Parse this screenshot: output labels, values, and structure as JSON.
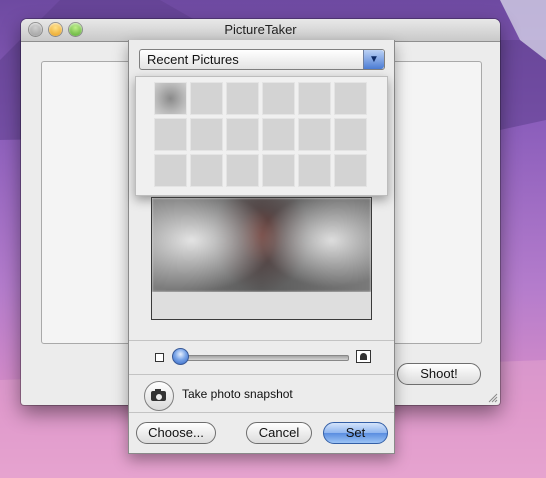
{
  "window": {
    "title": "PictureTaker",
    "shoot_label": "Shoot!"
  },
  "panel": {
    "popup_label": "Recent Pictures",
    "recent_pictures": [
      {
        "filled": true
      },
      {
        "filled": false
      },
      {
        "filled": false
      },
      {
        "filled": false
      },
      {
        "filled": false
      },
      {
        "filled": false
      },
      {
        "filled": false
      },
      {
        "filled": false
      },
      {
        "filled": false
      },
      {
        "filled": false
      },
      {
        "filled": false
      },
      {
        "filled": false
      },
      {
        "filled": false
      },
      {
        "filled": false
      },
      {
        "filled": false
      },
      {
        "filled": false
      },
      {
        "filled": false
      },
      {
        "filled": false
      }
    ],
    "zoom_level": 0.0,
    "snapshot_label": "Take photo snapshot",
    "buttons": {
      "choose": "Choose...",
      "cancel": "Cancel",
      "set": "Set"
    }
  },
  "colors": {
    "accent": "#4b7cd4",
    "desktop": "#8a5dbb"
  }
}
